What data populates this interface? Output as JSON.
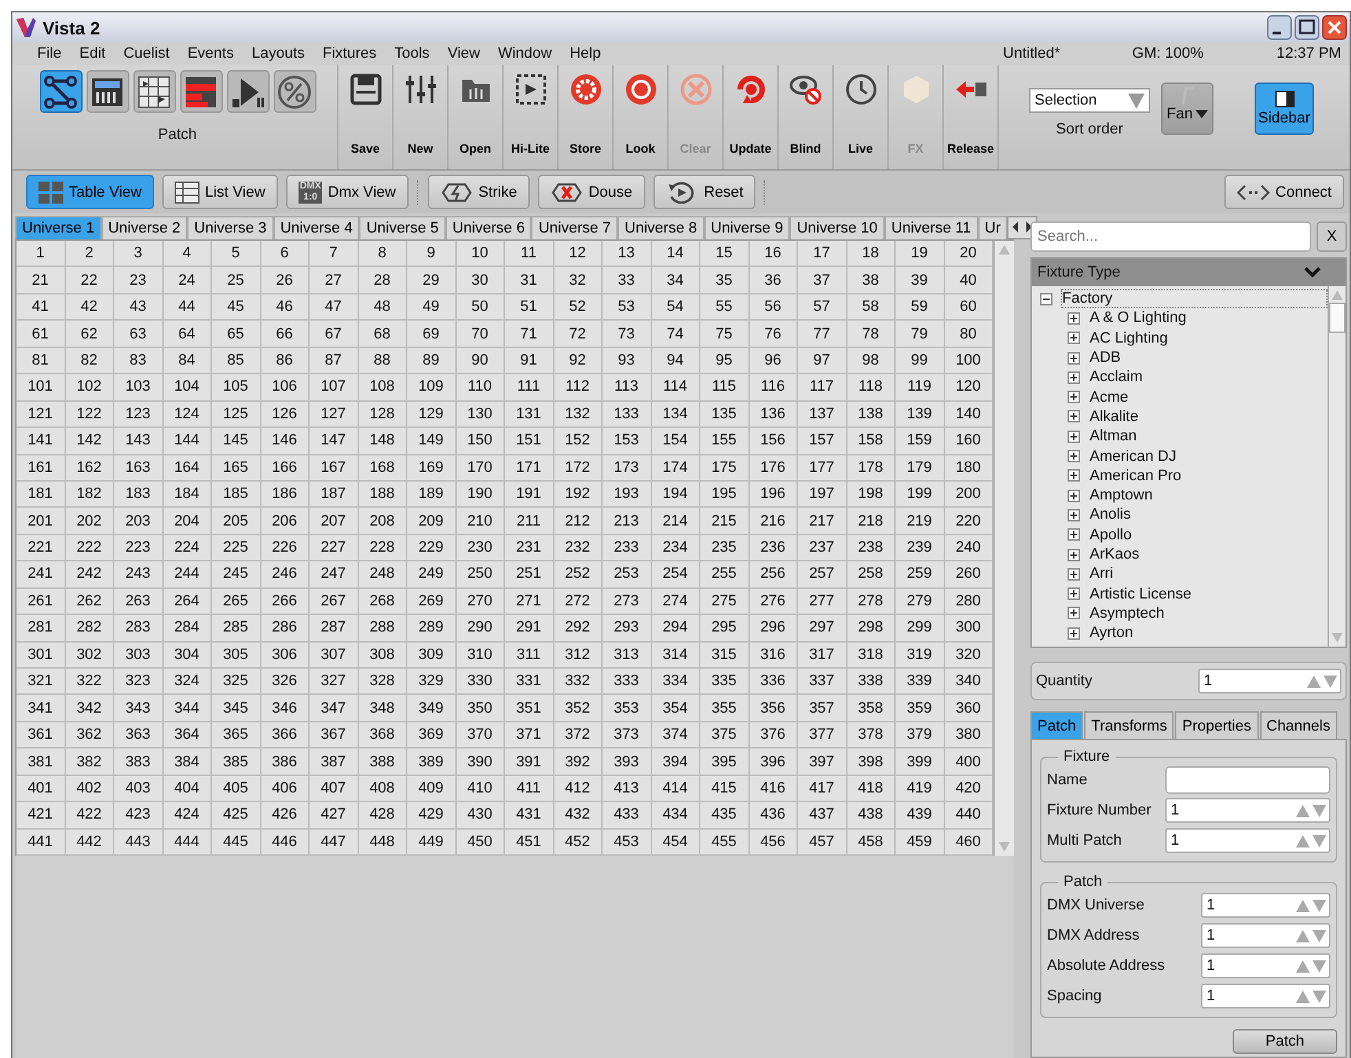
{
  "window": {
    "title": "Vista 2"
  },
  "menu": [
    "File",
    "Edit",
    "Cuelist",
    "Events",
    "Layouts",
    "Fixtures",
    "Tools",
    "View",
    "Window",
    "Help"
  ],
  "status": {
    "document": "Untitled*",
    "grand_master": "GM: 100%",
    "time": "12:37 PM"
  },
  "toolbar": {
    "patch_group": {
      "label": "Patch",
      "tiles": [
        {
          "selected": true
        },
        {
          "selected": false
        },
        {
          "selected": false
        },
        {
          "selected": false
        },
        {
          "selected": false
        },
        {
          "selected": false
        }
      ]
    },
    "buttons": [
      {
        "label": "Save",
        "disabled": false
      },
      {
        "label": "New",
        "disabled": false
      },
      {
        "label": "Open",
        "disabled": false
      },
      {
        "label": "Hi-Lite",
        "disabled": false
      },
      {
        "label": "Store",
        "disabled": false
      },
      {
        "label": "Look",
        "disabled": false
      },
      {
        "label": "Clear",
        "disabled": true
      },
      {
        "label": "Update",
        "disabled": false
      },
      {
        "label": "Blind",
        "disabled": false
      },
      {
        "label": "Live",
        "disabled": false
      },
      {
        "label": "FX",
        "disabled": true
      },
      {
        "label": "Release",
        "disabled": false
      }
    ],
    "sort": {
      "value": "Selection",
      "label": "Sort order"
    },
    "fan": {
      "label": "Fan",
      "disabled": true
    },
    "sidebar": {
      "label": "Sidebar",
      "selected": true
    }
  },
  "view_bar": {
    "views": [
      {
        "label": "Table View",
        "selected": true
      },
      {
        "label": "List View",
        "selected": false
      },
      {
        "label": "Dmx View",
        "selected": false,
        "icon_text": [
          "DMX",
          "1:0"
        ]
      }
    ],
    "actions": [
      "Strike",
      "Douse",
      "Reset"
    ],
    "connect": "Connect"
  },
  "universe_tabs": [
    {
      "label": "Universe 1",
      "selected": true
    },
    {
      "label": "Universe 2",
      "selected": false
    },
    {
      "label": "Universe 3",
      "selected": false
    },
    {
      "label": "Universe 4",
      "selected": false
    },
    {
      "label": "Universe 5",
      "selected": false
    },
    {
      "label": "Universe 6",
      "selected": false
    },
    {
      "label": "Universe 7",
      "selected": false
    },
    {
      "label": "Universe 8",
      "selected": false
    },
    {
      "label": "Universe 9",
      "selected": false
    },
    {
      "label": "Universe 10",
      "selected": false
    },
    {
      "label": "Universe 11",
      "selected": false
    },
    {
      "label": "Ur",
      "selected": false
    }
  ],
  "grid": {
    "rows": [
      [
        "1",
        "2",
        "3",
        "4",
        "5",
        "6",
        "7",
        "8",
        "9",
        "10",
        "11",
        "12",
        "13",
        "14",
        "15",
        "16",
        "17",
        "18",
        "19",
        "20"
      ],
      [
        "21",
        "22",
        "23",
        "24",
        "25",
        "26",
        "27",
        "28",
        "29",
        "30",
        "31",
        "32",
        "33",
        "34",
        "35",
        "36",
        "37",
        "38",
        "39",
        "40"
      ],
      [
        "41",
        "42",
        "43",
        "44",
        "45",
        "46",
        "47",
        "48",
        "49",
        "50",
        "51",
        "52",
        "53",
        "54",
        "55",
        "56",
        "57",
        "58",
        "59",
        "60"
      ],
      [
        "61",
        "62",
        "63",
        "64",
        "65",
        "66",
        "67",
        "68",
        "69",
        "70",
        "71",
        "72",
        "73",
        "74",
        "75",
        "76",
        "77",
        "78",
        "79",
        "80"
      ],
      [
        "81",
        "82",
        "83",
        "84",
        "85",
        "86",
        "87",
        "88",
        "89",
        "90",
        "91",
        "92",
        "93",
        "94",
        "95",
        "96",
        "97",
        "98",
        "99",
        "100"
      ],
      [
        "101",
        "102",
        "103",
        "104",
        "105",
        "106",
        "107",
        "108",
        "109",
        "110",
        "111",
        "112",
        "113",
        "114",
        "115",
        "116",
        "117",
        "118",
        "119",
        "120"
      ],
      [
        "121",
        "122",
        "123",
        "124",
        "125",
        "126",
        "127",
        "128",
        "129",
        "130",
        "131",
        "132",
        "133",
        "134",
        "135",
        "136",
        "137",
        "138",
        "139",
        "140"
      ],
      [
        "141",
        "142",
        "143",
        "144",
        "145",
        "146",
        "147",
        "148",
        "149",
        "150",
        "151",
        "152",
        "153",
        "154",
        "155",
        "156",
        "157",
        "158",
        "159",
        "160"
      ],
      [
        "161",
        "162",
        "163",
        "164",
        "165",
        "166",
        "167",
        "168",
        "169",
        "170",
        "171",
        "172",
        "173",
        "174",
        "175",
        "176",
        "177",
        "178",
        "179",
        "180"
      ],
      [
        "181",
        "182",
        "183",
        "184",
        "185",
        "186",
        "187",
        "188",
        "189",
        "190",
        "191",
        "192",
        "193",
        "194",
        "195",
        "196",
        "197",
        "198",
        "199",
        "200"
      ],
      [
        "201",
        "202",
        "203",
        "204",
        "205",
        "206",
        "207",
        "208",
        "209",
        "210",
        "211",
        "212",
        "213",
        "214",
        "215",
        "216",
        "217",
        "218",
        "219",
        "220"
      ],
      [
        "221",
        "222",
        "223",
        "224",
        "225",
        "226",
        "227",
        "228",
        "229",
        "230",
        "231",
        "232",
        "233",
        "234",
        "235",
        "236",
        "237",
        "238",
        "239",
        "240"
      ],
      [
        "241",
        "242",
        "243",
        "244",
        "245",
        "246",
        "247",
        "248",
        "249",
        "250",
        "251",
        "252",
        "253",
        "254",
        "255",
        "256",
        "257",
        "258",
        "259",
        "260"
      ],
      [
        "261",
        "262",
        "263",
        "264",
        "265",
        "266",
        "267",
        "268",
        "269",
        "270",
        "271",
        "272",
        "273",
        "274",
        "275",
        "276",
        "277",
        "278",
        "279",
        "280"
      ],
      [
        "281",
        "282",
        "283",
        "284",
        "285",
        "286",
        "287",
        "288",
        "289",
        "290",
        "291",
        "292",
        "293",
        "294",
        "295",
        "296",
        "297",
        "298",
        "299",
        "300"
      ],
      [
        "301",
        "302",
        "303",
        "304",
        "305",
        "306",
        "307",
        "308",
        "309",
        "310",
        "311",
        "312",
        "313",
        "314",
        "315",
        "316",
        "317",
        "318",
        "319",
        "320"
      ],
      [
        "321",
        "322",
        "323",
        "324",
        "325",
        "326",
        "327",
        "328",
        "329",
        "330",
        "331",
        "332",
        "333",
        "334",
        "335",
        "336",
        "337",
        "338",
        "339",
        "340"
      ],
      [
        "341",
        "342",
        "343",
        "344",
        "345",
        "346",
        "347",
        "348",
        "349",
        "350",
        "351",
        "352",
        "353",
        "354",
        "355",
        "356",
        "357",
        "358",
        "359",
        "360"
      ],
      [
        "361",
        "362",
        "363",
        "364",
        "365",
        "366",
        "367",
        "368",
        "369",
        "370",
        "371",
        "372",
        "373",
        "374",
        "375",
        "376",
        "377",
        "378",
        "379",
        "380"
      ],
      [
        "381",
        "382",
        "383",
        "384",
        "385",
        "386",
        "387",
        "388",
        "389",
        "390",
        "391",
        "392",
        "393",
        "394",
        "395",
        "396",
        "397",
        "398",
        "399",
        "400"
      ],
      [
        "401",
        "402",
        "403",
        "404",
        "405",
        "406",
        "407",
        "408",
        "409",
        "410",
        "411",
        "412",
        "413",
        "414",
        "415",
        "416",
        "417",
        "418",
        "419",
        "420"
      ],
      [
        "421",
        "422",
        "423",
        "424",
        "425",
        "426",
        "427",
        "428",
        "429",
        "430",
        "431",
        "432",
        "433",
        "434",
        "435",
        "436",
        "437",
        "438",
        "439",
        "440"
      ],
      [
        "441",
        "442",
        "443",
        "444",
        "445",
        "446",
        "447",
        "448",
        "449",
        "450",
        "451",
        "452",
        "453",
        "454",
        "455",
        "456",
        "457",
        "458",
        "459",
        "460"
      ]
    ]
  },
  "sidebar": {
    "search": {
      "placeholder": "Search..."
    },
    "clear_button": "X",
    "tree_header": "Fixture Type",
    "tree": [
      {
        "label": "Factory",
        "expanded": true,
        "selected": true,
        "children": [
          {
            "label": "A & O Lighting",
            "expanded": false,
            "selected": false
          },
          {
            "label": "AC Lighting",
            "expanded": false,
            "selected": false
          },
          {
            "label": "ADB",
            "expanded": false,
            "selected": false
          },
          {
            "label": "Acclaim",
            "expanded": false,
            "selected": false
          },
          {
            "label": "Acme",
            "expanded": false,
            "selected": false
          },
          {
            "label": "Alkalite",
            "expanded": false,
            "selected": false
          },
          {
            "label": "Altman",
            "expanded": false,
            "selected": false
          },
          {
            "label": "American DJ",
            "expanded": false,
            "selected": false
          },
          {
            "label": "American Pro",
            "expanded": false,
            "selected": false
          },
          {
            "label": "Amptown",
            "expanded": false,
            "selected": false
          },
          {
            "label": "Anolis",
            "expanded": false,
            "selected": false
          },
          {
            "label": "Apollo",
            "expanded": false,
            "selected": false
          },
          {
            "label": "ArKaos",
            "expanded": false,
            "selected": false
          },
          {
            "label": "Arri",
            "expanded": false,
            "selected": false
          },
          {
            "label": "Artistic License",
            "expanded": false,
            "selected": false
          },
          {
            "label": "Asymptech",
            "expanded": false,
            "selected": false
          },
          {
            "label": "Ayrton",
            "expanded": false,
            "selected": false
          }
        ]
      }
    ],
    "quantity": {
      "label": "Quantity",
      "value": "1"
    },
    "tabs": [
      {
        "label": "Patch",
        "selected": true
      },
      {
        "label": "Transforms",
        "selected": false
      },
      {
        "label": "Properties",
        "selected": false
      },
      {
        "label": "Channels",
        "selected": false
      }
    ],
    "groups": [
      {
        "title": "Fixture",
        "fields": [
          {
            "label": "Name",
            "kind": "text"
          },
          {
            "label": "Fixture Number",
            "kind": "spin",
            "value": "1"
          },
          {
            "label": "Multi Patch",
            "kind": "spin",
            "value": "1"
          }
        ]
      },
      {
        "title": "Patch",
        "fields": [
          {
            "label": "DMX Universe",
            "kind": "spin",
            "value": "1"
          },
          {
            "label": "DMX Address",
            "kind": "spin",
            "value": "1"
          },
          {
            "label": "Absolute Address",
            "kind": "spin",
            "value": "1"
          },
          {
            "label": "Spacing",
            "kind": "spin",
            "value": "1"
          }
        ]
      }
    ],
    "patch_button": "Patch"
  }
}
